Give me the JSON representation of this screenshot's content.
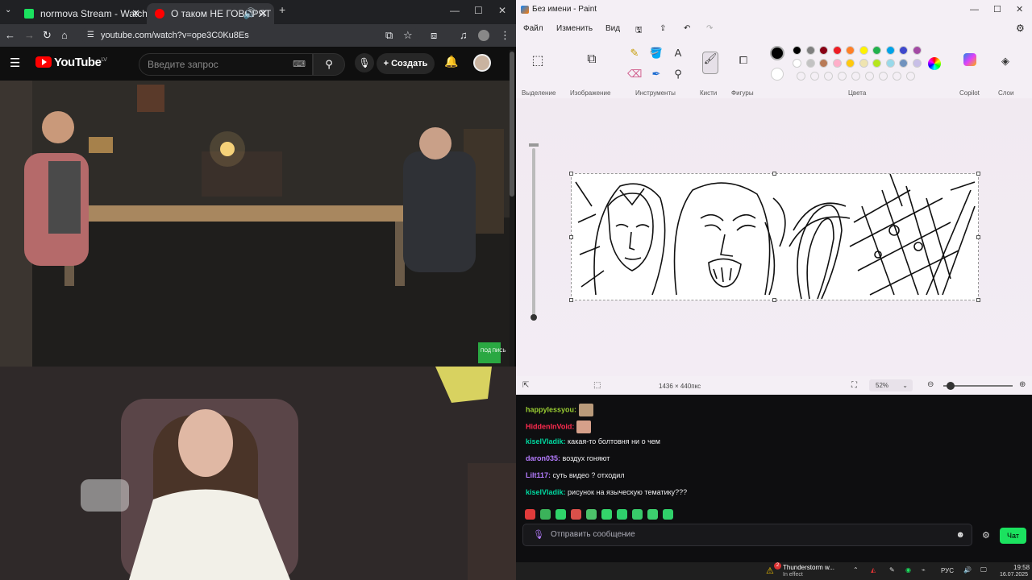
{
  "browser": {
    "tabs": [
      {
        "label": "normova Stream - Watch Live o"
      },
      {
        "label": "О таком НЕ ГОВОРЯТ вслу"
      }
    ],
    "address": "youtube.com/watch?v=ope3C0Ku8Es"
  },
  "youtube": {
    "brand": "YouTube",
    "region": "LV",
    "search_placeholder": "Введите запрос",
    "create_label": "Создать"
  },
  "video": {
    "corner_badge": "ПОД ПИСЬ"
  },
  "paint": {
    "title": "Без имени - Paint",
    "menu": {
      "file": "Файл",
      "edit": "Изменить",
      "view": "Вид"
    },
    "groups": {
      "selection": "Выделение",
      "image": "Изображение",
      "tools": "Инструменты",
      "brushes": "Кисти",
      "shapes": "Фигуры",
      "colors": "Цвета",
      "copilot": "Copilot",
      "layers": "Слои"
    },
    "status": {
      "dimensions": "1436 × 440пкс",
      "zoom": "52%"
    },
    "colors": {
      "row1": [
        "#000000",
        "#7f7f7f",
        "#880015",
        "#ed1c24",
        "#ff7f27",
        "#fff200",
        "#22b14c",
        "#00a2e8",
        "#3f48cc",
        "#a349a4"
      ],
      "row2": [
        "#ffffff",
        "#c3c3c3",
        "#b97a57",
        "#ffaec9",
        "#ffc90e",
        "#efe4b0",
        "#b5e61d",
        "#99d9ea",
        "#7092be",
        "#c8bfe7"
      ]
    }
  },
  "chat": {
    "messages": [
      {
        "user": "happylessyou:",
        "color": "#9acd32",
        "text": ""
      },
      {
        "user": "HiddenInVoid:",
        "color": "#ff2b4f",
        "text": ""
      },
      {
        "user": "kiselVladik:",
        "color": "#00d9a0",
        "text": "какая-то болтовня ни о чем"
      },
      {
        "user": "daron035:",
        "color": "#b57cff",
        "text": "воздух гоняют"
      },
      {
        "user": "Lilt117:",
        "color": "#b57cff",
        "text": "суть видео ? отходил"
      },
      {
        "user": "kiselVladik:",
        "color": "#00d9a0",
        "text": "рисунок на языческую тематику???"
      }
    ],
    "input_placeholder": "Отправить сообщение",
    "send_label": "Чат"
  },
  "taskbar": {
    "weather_title": "Thunderstorm w...",
    "weather_sub": "In effect",
    "weather_badge": "2",
    "language": "РУС",
    "time": "19:58",
    "date": "16.07.2025"
  }
}
